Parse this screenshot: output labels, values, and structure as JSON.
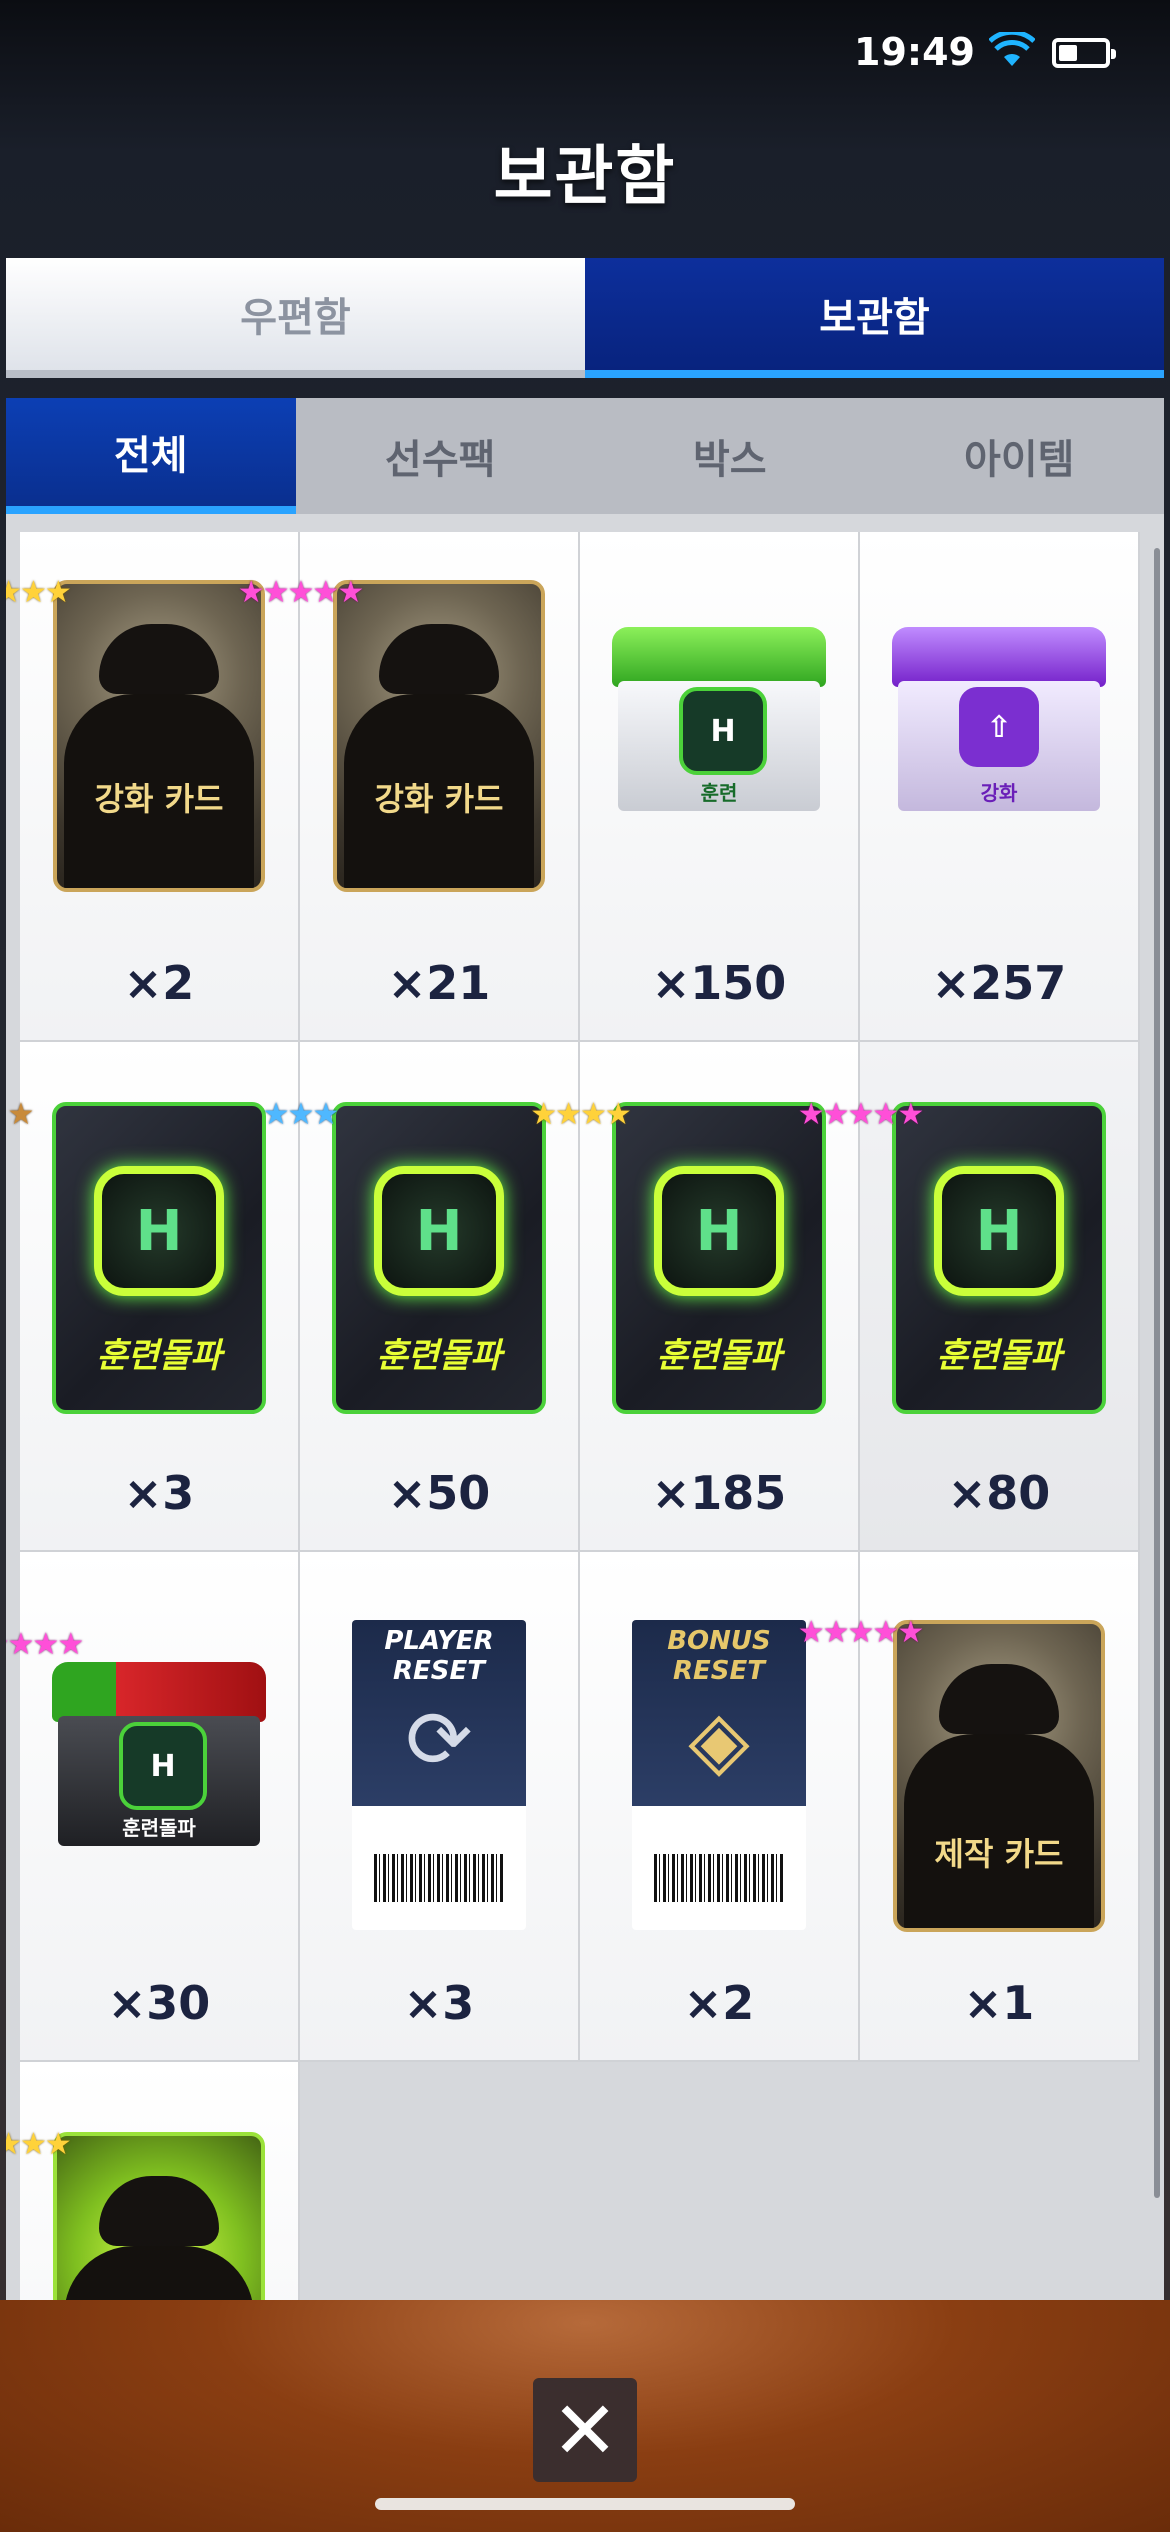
{
  "status": {
    "time": "19:49"
  },
  "header": {
    "title": "보관함"
  },
  "main_tabs": [
    {
      "label": "우편함",
      "active": false
    },
    {
      "label": "보관함",
      "active": true
    }
  ],
  "sub_tabs": [
    {
      "label": "전체",
      "active": true
    },
    {
      "label": "선수팩",
      "active": false
    },
    {
      "label": "박스",
      "active": false
    },
    {
      "label": "아이템",
      "active": false
    }
  ],
  "items": [
    {
      "label": "강화 카드",
      "stars": "★★★★",
      "quantity": "×2"
    },
    {
      "label": "강화 카드",
      "stars": "★★★★★",
      "quantity": "×21"
    },
    {
      "label": "훈련",
      "quantity": "×150"
    },
    {
      "label": "강화",
      "quantity": "×257"
    },
    {
      "label": "훈련돌파",
      "stars": "★",
      "quantity": "×3"
    },
    {
      "label": "훈련돌파",
      "stars": "★★★",
      "quantity": "×50"
    },
    {
      "label": "훈련돌파",
      "stars": "★★★★",
      "quantity": "×185"
    },
    {
      "label": "훈련돌파",
      "stars": "★★★★★",
      "quantity": "×80"
    },
    {
      "label": "훈련돌파",
      "stars": "★★★★★",
      "quantity": "×30"
    },
    {
      "label": "PLAYER RESET",
      "quantity": "×3"
    },
    {
      "label": "BONUS RESET",
      "quantity": "×2"
    },
    {
      "label": "제작 카드",
      "stars": "★★★★★",
      "quantity": "×1"
    },
    {
      "stars": "★★★★"
    }
  ],
  "colors": {
    "tab_active": "#0a2f8f",
    "tab_accent": "#2aa3ff",
    "star_gold": "#ffd23a",
    "star_pink": "#ff4fd8",
    "training_label": "#e8ff35"
  },
  "close": {
    "icon": "close-icon"
  }
}
